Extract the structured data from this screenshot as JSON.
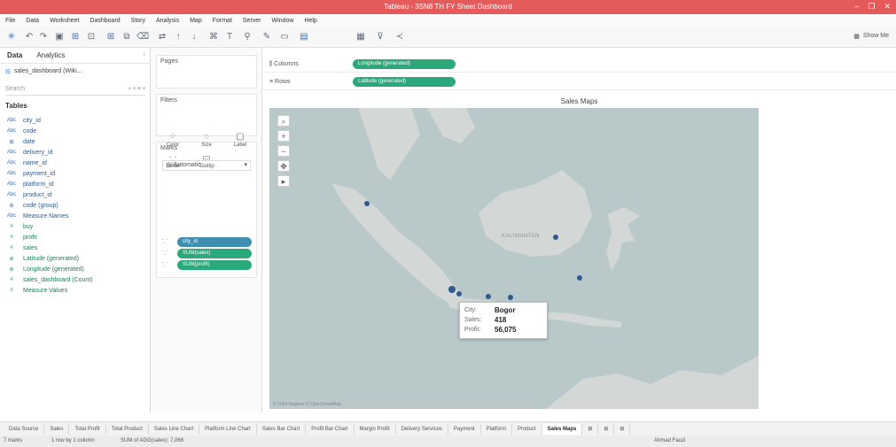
{
  "window": {
    "title": "Tableau - 3SN8 TH FY Sheet Dashboard",
    "controls": [
      "–",
      "❐",
      "✕"
    ]
  },
  "menu": [
    "File",
    "Data",
    "Worksheet",
    "Dashboard",
    "Story",
    "Analysis",
    "Map",
    "Format",
    "Server",
    "Window",
    "Help"
  ],
  "toolbar": {
    "show_me_label": "Show Me"
  },
  "data_pane": {
    "tab_data": "Data",
    "tab_analytics": "Analytics",
    "datasource": "sales_dashboard (Wiki...",
    "search_placeholder": "Search",
    "table_name": "Tables",
    "fields": [
      {
        "type": "Abc",
        "name": "city_id",
        "kind": "dim"
      },
      {
        "type": "Abc",
        "name": "code",
        "kind": "dim"
      },
      {
        "type": "⊞",
        "name": "date",
        "kind": "dim"
      },
      {
        "type": "Abc",
        "name": "delivery_id",
        "kind": "dim"
      },
      {
        "type": "Abc",
        "name": "name_id",
        "kind": "dim"
      },
      {
        "type": "Abc",
        "name": "payment_id",
        "kind": "dim"
      },
      {
        "type": "Abc",
        "name": "platform_id",
        "kind": "dim"
      },
      {
        "type": "Abc",
        "name": "product_id",
        "kind": "dim"
      },
      {
        "type": "⊕",
        "name": "code (group)",
        "kind": "dim"
      },
      {
        "type": "Abc",
        "name": "Measure Names",
        "kind": "dim"
      },
      {
        "type": "#",
        "name": "buy",
        "kind": "mea"
      },
      {
        "type": "#",
        "name": "profit",
        "kind": "mea"
      },
      {
        "type": "#",
        "name": "sales",
        "kind": "mea"
      },
      {
        "type": "⊕",
        "name": "Latitude (generated)",
        "kind": "mea"
      },
      {
        "type": "⊕",
        "name": "Longitude (generated)",
        "kind": "mea"
      },
      {
        "type": "#",
        "name": "sales_dashboard (Count)",
        "kind": "mea"
      },
      {
        "type": "#",
        "name": "Measure Values",
        "kind": "mea"
      }
    ]
  },
  "cards": {
    "pages_label": "Pages",
    "filters_label": "Filters",
    "marks_label": "Marks",
    "marks_type": "Automatic",
    "mark_buttons": [
      "Color",
      "Size",
      "Label",
      "Detail",
      "Tooltip"
    ],
    "mark_pills": [
      "city_id",
      "SUM(sales)",
      "SUM(profit)"
    ]
  },
  "shelves": {
    "columns_label": "Columns",
    "columns_pill": "Longitude (generated)",
    "rows_label": "Rows",
    "rows_pill": "Latitude (generated)"
  },
  "view": {
    "title": "Sales Maps",
    "map_label": "KALIMANTAN",
    "attribution": "© 2024 Mapbox © OpenStreetMap"
  },
  "tooltip": {
    "rows": [
      {
        "key": "City:",
        "value": "Bogor"
      },
      {
        "key": "Sales:",
        "value": "418"
      },
      {
        "key": "Profit:",
        "value": "56,075"
      }
    ]
  },
  "sheets": [
    "Data Source",
    "Sales",
    "Total Profit",
    "Total Product",
    "Sales Line Chart",
    "Platform Line Chart",
    "Sales Bar Chart",
    "Profit Bar Chart",
    "Margin Profit",
    "Delivery Services",
    "Payment",
    "Platform",
    "Product",
    "Sales Maps"
  ],
  "active_sheet": "Sales Maps",
  "status": {
    "marks": "7 marks",
    "rows_cols": "1 row by 1 column",
    "sum": "SUM of AGG(sales): 7,066",
    "user": "Ahmad Fauzi"
  }
}
